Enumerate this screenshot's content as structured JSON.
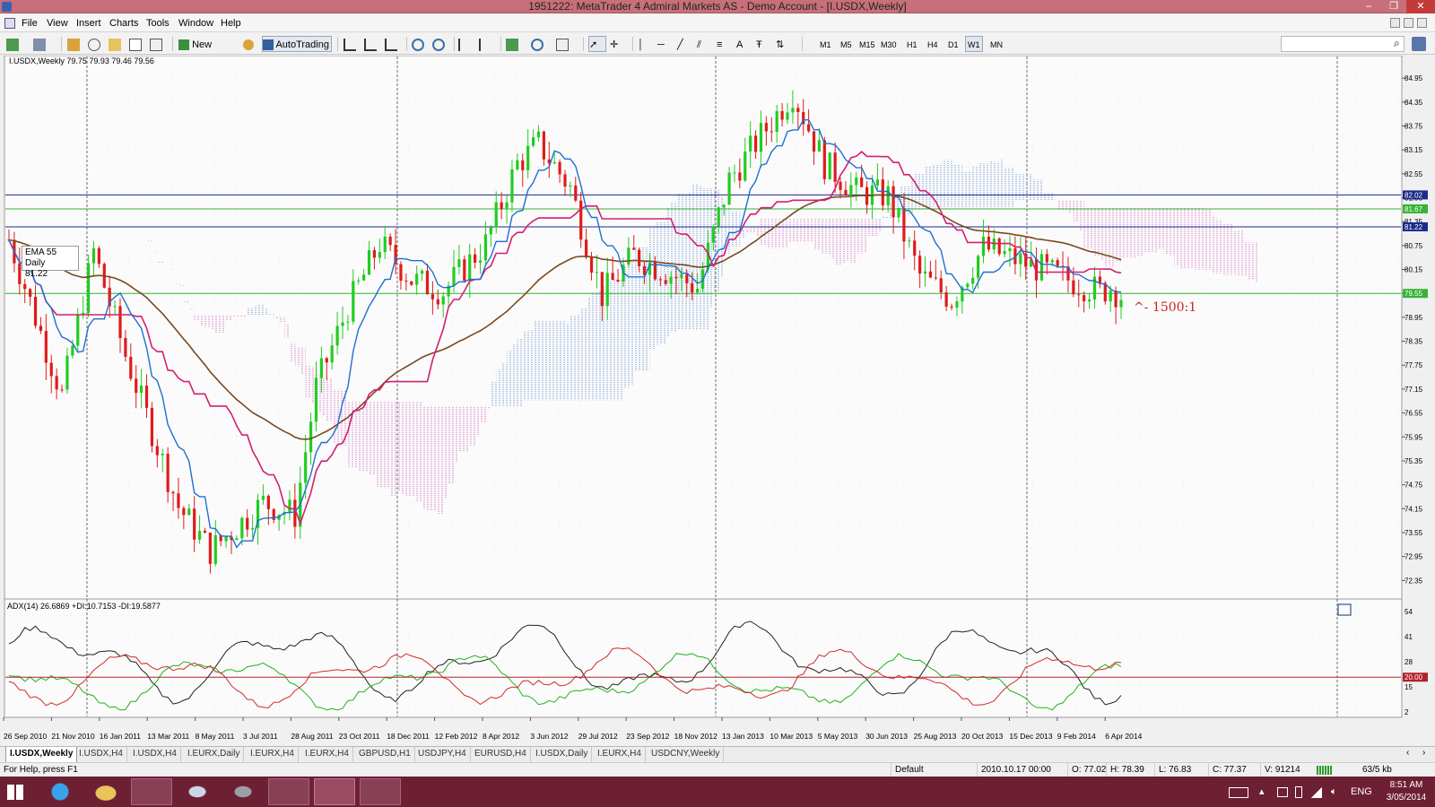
{
  "window": {
    "title": "1951222: MetaTrader 4 Admiral Markets AS - Demo Account - [I.USDX,Weekly]",
    "minimize": "–",
    "restore": "❐",
    "close": "✕"
  },
  "menu": [
    "File",
    "View",
    "Insert",
    "Charts",
    "Tools",
    "Window",
    "Help"
  ],
  "toolbar": {
    "new_order": "New Order",
    "autotrading": "AutoTrading",
    "timeframes": [
      "M1",
      "M5",
      "M15",
      "M30",
      "H1",
      "H4",
      "D1",
      "W1",
      "MN"
    ],
    "active_timeframe": "W1",
    "search_placeholder": ""
  },
  "chart": {
    "header": "I.USDX,Weekly  79.75 79.93 79.46 79.56",
    "ema_label": "EMA 55 Daily",
    "ema_value": "81.22",
    "annotation": "^- 1500:1",
    "price_ticks": [
      "84.95",
      "84.35",
      "83.75",
      "83.15",
      "82.55",
      "81.95",
      "81.35",
      "80.75",
      "80.15",
      "79.55",
      "78.95",
      "78.35",
      "77.75",
      "77.15",
      "76.55",
      "75.95",
      "75.35",
      "74.75",
      "74.15",
      "73.55",
      "72.95",
      "72.35"
    ],
    "price_markers": [
      {
        "value": "82.02",
        "color": "#1b2a8c"
      },
      {
        "value": "81.67",
        "color": "#35b335"
      },
      {
        "value": "81.22",
        "color": "#1b2a8c"
      },
      {
        "value": "79.55",
        "color": "#35b335"
      }
    ],
    "dates": [
      "26 Sep 2010",
      "21 Nov 2010",
      "16 Jan 2011",
      "13 Mar 2011",
      "8 May 2011",
      "3 Jul 2011",
      "28 Aug 2011",
      "23 Oct 2011",
      "18 Dec 2011",
      "12 Feb 2012",
      "8 Apr 2012",
      "3 Jun 2012",
      "29 Jul 2012",
      "23 Sep 2012",
      "18 Nov 2012",
      "13 Jan 2013",
      "10 Mar 2013",
      "5 May 2013",
      "30 Jun 2013",
      "25 Aug 2013",
      "20 Oct 2013",
      "15 Dec 2013",
      "9 Feb 2014",
      "6 Apr 2014"
    ],
    "adx_header": "ADX(14) 26.6869 +DI:10.7153 -DI:19.5877",
    "adx_ticks": [
      "54",
      "41",
      "28",
      "15",
      "2"
    ],
    "adx_level": "20.00"
  },
  "chart_tabs": [
    "I.USDX,Weekly",
    "I.USDX,H4",
    "I.USDX,H4",
    "I.EURX,Daily",
    "I.EURX,H4",
    "I.EURX,H4",
    "GBPUSD,H1",
    "USDJPY,H4",
    "EURUSD,H4",
    "I.USDX,Daily",
    "I.EURX,H4",
    "USDCNY,Weekly"
  ],
  "active_tab": 0,
  "status": {
    "help": "For Help, press F1",
    "profile": "Default",
    "time": "2010.10.17 00:00",
    "open": "O: 77.02",
    "high": "H: 78.39",
    "low": "L: 76.83",
    "close": "C: 77.37",
    "volume": "V: 91214",
    "traffic": "63/5 kb"
  },
  "taskbar": {
    "lang": "ENG",
    "time": "8:51 AM",
    "date": "3/05/2014"
  },
  "colors": {
    "bull": "#22cc22",
    "bear": "#e01b1b",
    "tenkan": "#1f6fd1",
    "kijun": "#d21f72",
    "ema": "#7a4a1e",
    "cloud_bull": "#6a8fcf",
    "cloud_bear": "#cf6ac0"
  }
}
